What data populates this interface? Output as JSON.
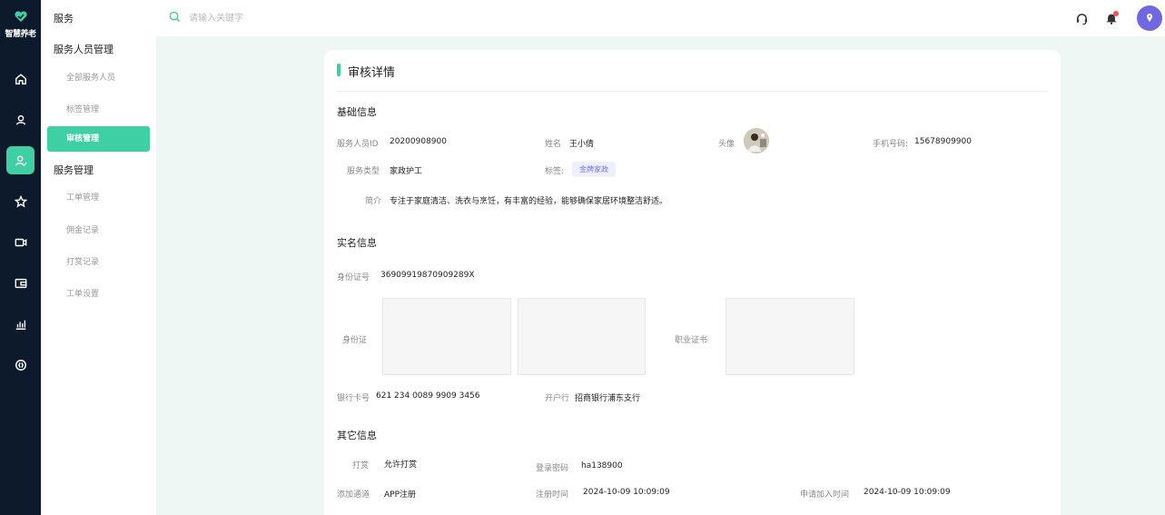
{
  "brand": {
    "name": "智慧养老"
  },
  "rail": {
    "icons": [
      "home-icon",
      "user-icon",
      "user-check-icon",
      "star-icon",
      "video-icon",
      "wallet-icon",
      "bar-chart-icon",
      "clock-icon"
    ],
    "active_index": 2
  },
  "subnav": {
    "top_label": "服务",
    "sections": [
      {
        "title": "服务人员管理",
        "items": [
          "全部服务人员",
          "标签管理",
          "审核管理"
        ]
      },
      {
        "title": "服务管理",
        "items": [
          "工单管理",
          "佣金记录",
          "打赏记录",
          "工单设置"
        ]
      }
    ],
    "active_item": "审核管理"
  },
  "topbar": {
    "search_placeholder": "请输入关键字"
  },
  "accent": "#3ecfa3",
  "card": {
    "title": "审核详情",
    "basic": {
      "title": "基础信息",
      "staff_id_label": "服务人员ID",
      "staff_id": "20200908900",
      "name_label": "姓名",
      "name": "王小倩",
      "avatar_label": "头像",
      "phone_label": "手机号码:",
      "phone": "15678909900",
      "type_label": "服务类型",
      "type": "家政护工",
      "tag_label": "标签:",
      "tag": "金牌家政",
      "intro_label": "简介",
      "intro": "专注于家庭清洁、洗衣与烹饪，有丰富的经验，能够确保家居环境整洁舒适。"
    },
    "identity": {
      "title": "实名信息",
      "id_label": "身份证号",
      "id_number": "36909919870909289X",
      "idcard_label": "身份证",
      "cert_label": "职业证书",
      "bank_label": "银行卡号",
      "bank_number": "621 234 0089 9909 3456",
      "branch_label": "开户行",
      "branch": "招商银行浦东支行"
    },
    "other": {
      "title": "其它信息",
      "tip_label": "打赏",
      "tip_value": "允许打赏",
      "password_label": "登录密码",
      "password": "ha138900",
      "channel_label": "添加通道",
      "channel": "APP注册",
      "register_label": "注册时间",
      "register_time": "2024-10-09 10:09:09",
      "apply_label": "申请加入时间",
      "apply_time": "2024-10-09 10:09:09"
    }
  }
}
